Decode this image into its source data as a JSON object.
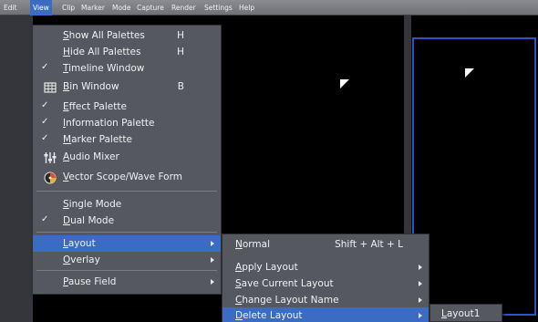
{
  "menubar": {
    "items": [
      "Edit",
      "View",
      "Clip",
      "Marker",
      "Mode",
      "Capture",
      "Render",
      "Settings",
      "Help"
    ],
    "active": "View"
  },
  "view_menu": {
    "items": [
      {
        "label": "Show All Palettes",
        "shortcut": "H",
        "checked": false,
        "icon": ""
      },
      {
        "label": "Hide All Palettes",
        "shortcut": "H",
        "checked": false,
        "icon": ""
      },
      {
        "label": "Timeline Window",
        "shortcut": "",
        "checked": true,
        "icon": ""
      },
      {
        "label": "Bin Window",
        "shortcut": "B",
        "checked": false,
        "icon": "bin-window-icon"
      },
      {
        "label": "Effect Palette",
        "shortcut": "",
        "checked": true,
        "icon": ""
      },
      {
        "label": "Information  Palette",
        "shortcut": "",
        "checked": true,
        "icon": ""
      },
      {
        "label": "Marker Palette",
        "shortcut": "",
        "checked": true,
        "icon": ""
      },
      {
        "label": "Audio Mixer",
        "shortcut": "",
        "checked": false,
        "icon": "audio-mixer-icon"
      },
      {
        "label": "Vector Scope/Wave Form",
        "shortcut": "",
        "checked": false,
        "icon": "vectorscope-icon"
      },
      {
        "label": "Single Mode",
        "shortcut": "",
        "checked": false,
        "icon": ""
      },
      {
        "label": "Dual Mode",
        "shortcut": "",
        "checked": true,
        "icon": ""
      },
      {
        "label": "Layout",
        "shortcut": "",
        "checked": false,
        "icon": ""
      },
      {
        "label": "Overlay",
        "shortcut": "",
        "checked": false,
        "icon": ""
      },
      {
        "label": "Pause Field",
        "shortcut": "",
        "checked": false,
        "icon": ""
      }
    ],
    "checkmark": "✓"
  },
  "layout_submenu": {
    "items": [
      {
        "label": "Normal",
        "shortcut": "Shift + Alt + L"
      },
      {
        "label": "Apply Layout",
        "shortcut": ""
      },
      {
        "label": "Save Current Layout",
        "shortcut": ""
      },
      {
        "label": "Change Layout Name",
        "shortcut": ""
      },
      {
        "label": "Delete Layout",
        "shortcut": ""
      }
    ]
  },
  "delete_submenu": {
    "items": [
      {
        "label": "Layout1"
      }
    ]
  },
  "colors": {
    "highlight": "#3a6cc4",
    "menu_bg": "#565860",
    "viewer_border": "#2a54c8"
  }
}
